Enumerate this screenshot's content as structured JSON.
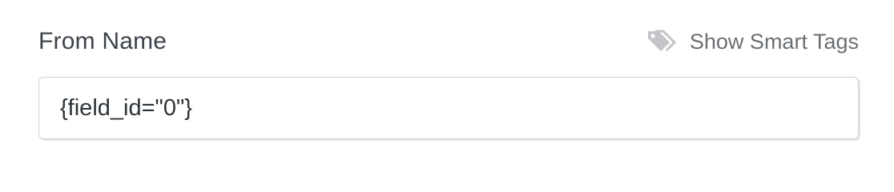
{
  "field": {
    "label": "From Name",
    "value": "{field_id=\"0\"}"
  },
  "smart_tags": {
    "label": "Show Smart Tags",
    "icon": "tags-icon",
    "color": "#c3c5c8"
  }
}
